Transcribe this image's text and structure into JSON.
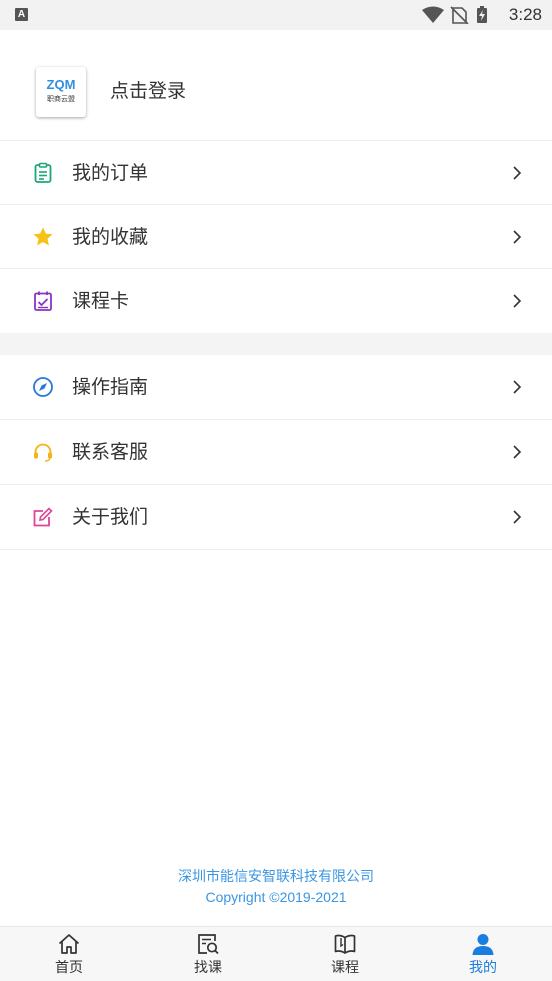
{
  "status_bar": {
    "time": "3:28",
    "notification_icon_letter": "A"
  },
  "profile": {
    "logo_text": "ZQM",
    "logo_subtext": "职商云盟",
    "login_label": "点击登录"
  },
  "menu_group_1": [
    {
      "label": "我的订单",
      "icon": "clipboard-icon",
      "color": "#1aa678"
    },
    {
      "label": "我的收藏",
      "icon": "star-icon",
      "color": "#f6c21a"
    },
    {
      "label": "课程卡",
      "icon": "checklist-card-icon",
      "color": "#8a33c6"
    }
  ],
  "menu_group_2": [
    {
      "label": "操作指南",
      "icon": "compass-icon",
      "color": "#2a78db"
    },
    {
      "label": "联系客服",
      "icon": "headset-icon",
      "color": "#f6b21a"
    },
    {
      "label": "关于我们",
      "icon": "edit-note-icon",
      "color": "#e0449a"
    }
  ],
  "footer": {
    "company": "深圳市能信安智联科技有限公司",
    "copyright": "Copyright ©2019-2021"
  },
  "tab_bar": {
    "tabs": [
      {
        "label": "首页",
        "icon": "home-icon",
        "active": false
      },
      {
        "label": "找课",
        "icon": "search-course-icon",
        "active": false
      },
      {
        "label": "课程",
        "icon": "book-icon",
        "active": false
      },
      {
        "label": "我的",
        "icon": "user-icon",
        "active": true
      }
    ],
    "active_color": "#1a7de0"
  }
}
